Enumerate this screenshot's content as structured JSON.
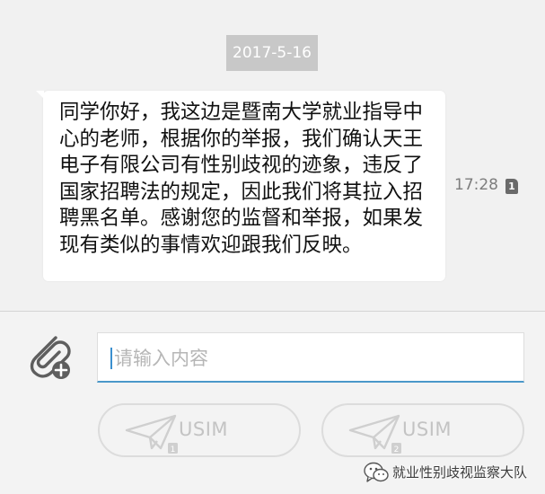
{
  "conversation": {
    "date": "2017-5-16",
    "message": {
      "text": "同学你好，我这边是暨南大学就业指导中心的老师，根据你的举报，我们确认天王电子有限公司有性别歧视的迹象，违反了国家招聘法的规定，因此我们将其拉入招聘黑名单。感谢您的监督和举报，如果发现有类似的事情欢迎跟我们反映。",
      "time": "17:28",
      "sim_badge": "1"
    }
  },
  "composer": {
    "attach_icon": "paperclip-plus-icon",
    "input_placeholder": "请输入内容",
    "send_buttons": [
      {
        "label": "USIM",
        "sim": "1",
        "icon": "paper-plane-icon"
      },
      {
        "label": "USIM",
        "sim": "2",
        "icon": "paper-plane-icon"
      }
    ]
  },
  "watermark": {
    "text": "就业性别歧视监察大队",
    "icon": "wechat-logo-icon"
  },
  "colors": {
    "chat_background": "#f1f1f1",
    "bubble": "#ffffff",
    "date_chip": "#c8c8c8",
    "input_underline": "#4a98c9",
    "caret": "#3a8fcf"
  }
}
